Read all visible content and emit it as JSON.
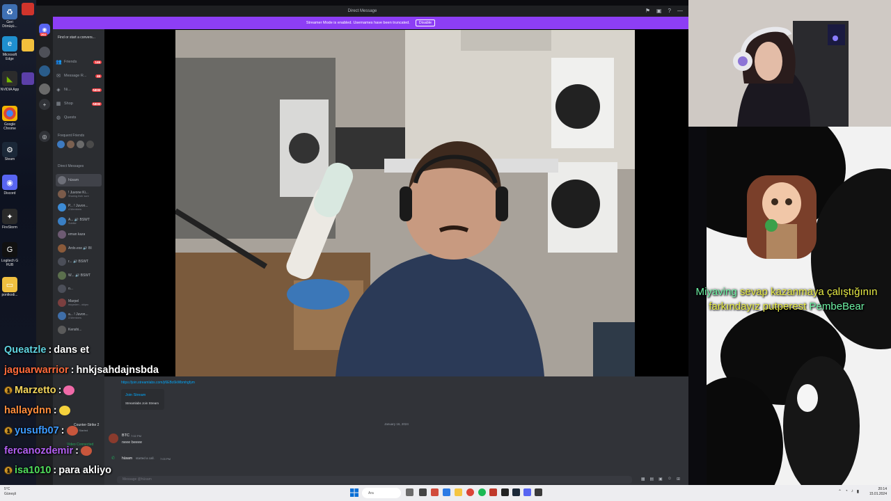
{
  "discord": {
    "window_title": "Direct Message",
    "streamer_banner": "Streamer Mode is enabled. Usernames have been truncated.",
    "disable_label": "Disable",
    "search_placeholder": "Find or start a convers...",
    "home_badge": "264",
    "nav": [
      {
        "label": "Friends",
        "badge": "146",
        "icon": "friends-icon"
      },
      {
        "label": "Message R...",
        "badge": "46",
        "icon": "message-requests-icon"
      },
      {
        "label": "Ni...",
        "badge": "NEW",
        "icon": "nitro-icon"
      },
      {
        "label": "Shop",
        "badge": "NEW",
        "icon": "shop-icon"
      },
      {
        "label": "Quests",
        "badge": "",
        "icon": "quests-icon"
      }
    ],
    "frequent_friends_label": "Frequent Friends",
    "direct_messages_label": "Direct Messages",
    "dms": [
      {
        "name": "hüsam",
        "sub": "",
        "color": "#6d6f78"
      },
      {
        "name": "! Juvone Ki...",
        "sub": "Sharing their scre",
        "color": "#7b5b4a"
      },
      {
        "name": "P... ! Juvon...",
        "sub": "4 Members",
        "color": "#3d8bd5"
      },
      {
        "name": "A... 🔊 BSWT",
        "sub": "Soldier",
        "color": "#3a7fc4"
      },
      {
        "name": "eman kaza",
        "sub": "",
        "color": "#6d5a72"
      },
      {
        "name": "Ardo.exe 🔊 BI",
        "sub": "",
        "color": "#8a5a3a"
      },
      {
        "name": "r... 🔊 BSWT",
        "sub": "",
        "color": "#4b4e58"
      },
      {
        "name": "W... 🔊 BSWT",
        "sub": "",
        "color": "#5b6f4d"
      },
      {
        "name": "o...",
        "sub": "",
        "color": "#4c4f59"
      },
      {
        "name": "Marpel",
        "sub": "muyeden - okipro",
        "color": "#7b3f3f"
      },
      {
        "name": "a... ! Juvon...",
        "sub": "3 Members",
        "color": "#3f6ea8"
      },
      {
        "name": "Kenshi...",
        "sub": "",
        "color": "#5a5a5a"
      }
    ],
    "game_activity": {
      "title": "Counter-Strike 2",
      "sub": "Not Started"
    },
    "video_connected": "Video Connected",
    "chat": {
      "link": "https://join.streamlabs.com/j/6EBc6kWbmhgfym",
      "embed_title": "Join Stream",
      "embed_sub": "Streamlabs Join Stream",
      "date_divider": "January 16, 2024",
      "message_author": "BTC",
      "message_time": "7:02 PM",
      "message_text": "neee beeee",
      "call_author": "hüsam",
      "call_text": "started a call.",
      "call_time": "7:03 PM",
      "input_placeholder": "Message @hüsam"
    }
  },
  "twitch_chat": [
    {
      "user": "Queatzle",
      "user_color": "#5fd3e0",
      "message": "dans et",
      "badge": false,
      "emote": false
    },
    {
      "user": "jaguarwarrior",
      "user_color": "#ff6a3a",
      "message": "hnkjsahdajnsbda",
      "badge": false,
      "emote": false
    },
    {
      "user": "Marzetto",
      "user_color": "#f2d45a",
      "message": "",
      "badge": true,
      "emote": true
    },
    {
      "user": "hallaydnn",
      "user_color": "#ff8c3b",
      "message": "",
      "badge": false,
      "emote": true
    },
    {
      "user": "yusufb07",
      "user_color": "#3c9bff",
      "message": "",
      "badge": true,
      "emote": true
    },
    {
      "user": "fercanozdemir",
      "user_color": "#b35ff2",
      "message": "",
      "badge": false,
      "emote": true
    },
    {
      "user": "isa1010",
      "user_color": "#4fdd5a",
      "message": "para akliyo",
      "badge": true,
      "emote": false
    }
  ],
  "alert": {
    "user1": "Miyaving",
    "text": "sevap kazanmaya çalıştığının farkındayız putperest",
    "user2": "PembeBear"
  },
  "desktop_icons": [
    {
      "label": "Geri Dönüşü..."
    },
    {
      "label": "Microsoft Edge"
    },
    {
      "label": "NVIDIA App"
    },
    {
      "label": "Google Chrome"
    },
    {
      "label": "Steam"
    },
    {
      "label": "Discord"
    },
    {
      "label": "FireStorm"
    },
    {
      "label": "Logitech G HUB"
    },
    {
      "label": "pontkodi..."
    }
  ],
  "taskbar": {
    "weather_temp": "5°C",
    "weather_desc": "Güneşli",
    "search_placeholder": "Ara",
    "time": "20:14",
    "date": "15.01.2024"
  },
  "colors": {
    "streamer_bar": "#8d3ef5",
    "discord_bg": "#313338",
    "sidebar_bg": "#2b2d31",
    "alert_yellow": "#e8ec45",
    "alert_green": "#6cf1a3"
  }
}
